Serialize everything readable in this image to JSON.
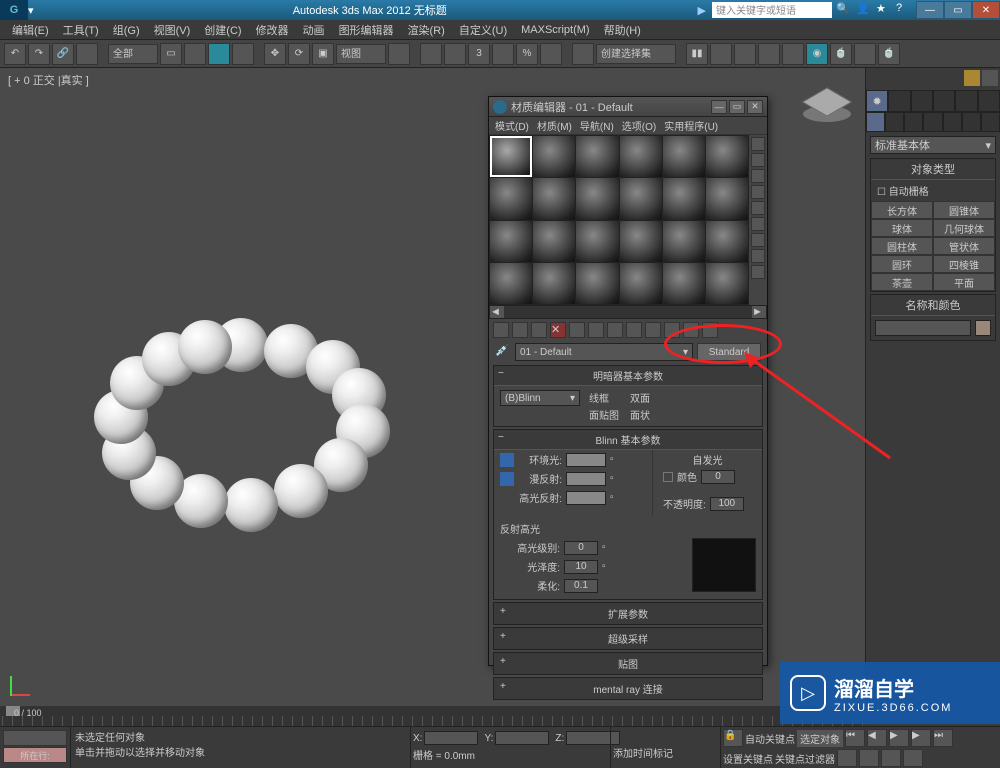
{
  "title": "Autodesk 3ds Max 2012    无标题",
  "search_placeholder": "键入关键字或短语",
  "menus": [
    "编辑(E)",
    "工具(T)",
    "组(G)",
    "视图(V)",
    "创建(C)",
    "修改器",
    "动画",
    "图形编辑器",
    "渲染(R)",
    "自定义(U)",
    "MAXScript(M)",
    "帮助(H)"
  ],
  "toolbar_dropdown": "全部",
  "toolbar_view": "视图",
  "toolbar_selset": "创建选择集",
  "viewport_label": "[ + 0 正交 |真实 ]",
  "command_panel": {
    "dropdown": "标准基本体",
    "section1_title": "对象类型",
    "autogrid": "自动栅格",
    "buttons": [
      [
        "长方体",
        "圆锥体"
      ],
      [
        "球体",
        "几何球体"
      ],
      [
        "圆柱体",
        "管状体"
      ],
      [
        "圆环",
        "四棱锥"
      ],
      [
        "茶壶",
        "平面"
      ]
    ],
    "section2_title": "名称和颜色"
  },
  "material_editor": {
    "title": "材质编辑器 - 01 - Default",
    "menus": [
      "模式(D)",
      "材质(M)",
      "导航(N)",
      "选项(O)",
      "实用程序(U)"
    ],
    "mat_name": "01 - Default",
    "type_button": "Standard",
    "rollout_shader": "明暗器基本参数",
    "shader": "(B)Blinn",
    "opts": [
      "线框",
      "双面",
      "面贴图",
      "面状"
    ],
    "rollout_blinn": "Blinn 基本参数",
    "self_illum": "自发光",
    "color": "颜色",
    "ambient": "环境光:",
    "diffuse": "漫反射:",
    "specular": "高光反射:",
    "opacity": "不透明度:",
    "opacity_val": "100",
    "color_val": "0",
    "hl_section": "反射高光",
    "hl_level": "高光级别:",
    "hl_level_val": "0",
    "gloss": "光泽度:",
    "gloss_val": "10",
    "soften": "柔化:",
    "soften_val": "0.1",
    "collapsed": [
      "扩展参数",
      "超级采样",
      "贴图",
      "mental ray 连接"
    ]
  },
  "timeline": "0 / 100",
  "status": {
    "row1": "未选定任何对象",
    "row2": "单击并拖动以选择并移动对象",
    "btn": "所在行:",
    "grid": "栅格 = 0.0mm",
    "addtime": "添加时间标记",
    "autokey": "自动关键点",
    "selkey": "选定对象",
    "setkey": "设置关键点",
    "keyfilter": "关键点过滤器"
  },
  "watermark": {
    "brand": "溜溜自学",
    "url": "ZIXUE.3D66.COM"
  }
}
